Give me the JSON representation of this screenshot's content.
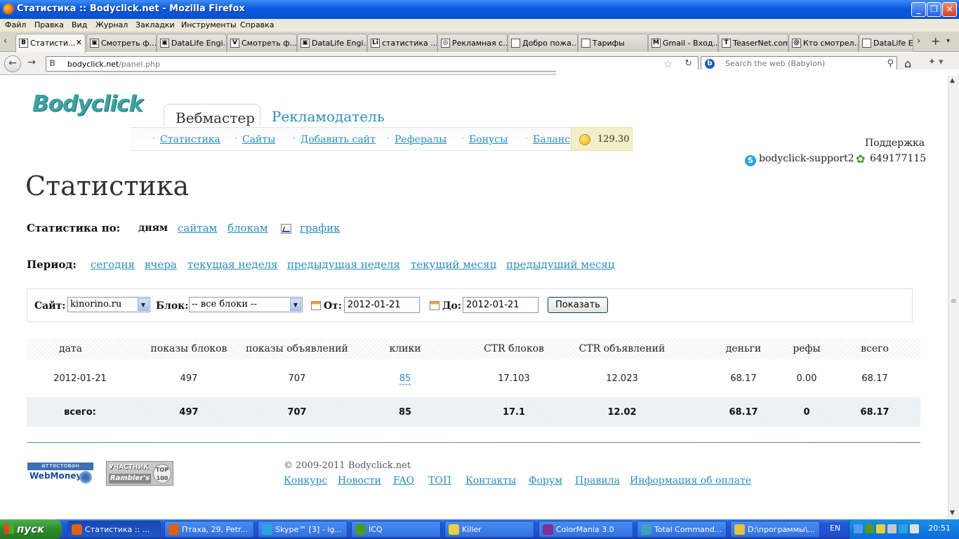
{
  "window": {
    "title": "Статистика :: Bodyclick.net - Mozilla Firefox"
  },
  "menu": [
    "Файл",
    "Правка",
    "Вид",
    "Журнал",
    "Закладки",
    "Инструменты",
    "Справка"
  ],
  "tabs": [
    {
      "label": "Статисти...",
      "icon": "B",
      "active": true
    },
    {
      "label": "Смотреть ф...",
      "icon": "▣"
    },
    {
      "label": "DataLife Engi...",
      "icon": "▣"
    },
    {
      "label": "Смотреть ф...",
      "icon": "V"
    },
    {
      "label": "DataLife Engi...",
      "icon": "▣"
    },
    {
      "label": "статистика ...",
      "icon": "Li"
    },
    {
      "label": "Рекламная с...",
      "icon": "◎"
    },
    {
      "label": "Добро пожа...",
      "icon": ""
    },
    {
      "label": "Тарифы",
      "icon": ""
    },
    {
      "label": "Gmail - Вход...",
      "icon": "M"
    },
    {
      "label": "TeaserNet.com",
      "icon": "T"
    },
    {
      "label": "Кто смотрел...",
      "icon": "@"
    },
    {
      "label": "DataLife En",
      "icon": ""
    }
  ],
  "nav": {
    "url_host": "bodyclick.net",
    "url_path": "/panel.php",
    "search_placeholder": "Search the web (Babylon)"
  },
  "site": {
    "logo": "Bodyclick",
    "main_tabs": {
      "webmaster": "Вебмастер",
      "advertiser": "Рекламодатель"
    },
    "subnav": [
      "Статистика",
      "Сайты",
      "Добавить сайт",
      "Рефералы",
      "Бонусы",
      "Баланс"
    ],
    "balance": "129.30",
    "support": {
      "label": "Поддержка",
      "skype": "bodyclick-support2",
      "icq": "649177115"
    }
  },
  "page": {
    "title": "Статистика",
    "stat_by": {
      "label": "Статистика по:",
      "current": "дням",
      "links": [
        "сайтам",
        "блокам",
        "график"
      ]
    },
    "period": {
      "label": "Период:",
      "links": [
        "сегодня",
        "вчера",
        "текущая неделя",
        "предыдущая неделя",
        "текущий месяц",
        "предыдущий месяц"
      ]
    },
    "filter": {
      "site_label": "Сайт:",
      "site_value": "kinorino.ru",
      "block_label": "Блок:",
      "block_value": "-- все блоки --",
      "from_label": "От:",
      "from_value": "2012-01-21",
      "to_label": "До:",
      "to_value": "2012-01-21",
      "show_button": "Показать"
    },
    "table": {
      "headers": [
        "дата",
        "показы блоков",
        "показы объявлений",
        "клики",
        "CTR блоков",
        "CTR объявлений",
        "деньги",
        "рефы",
        "всего"
      ],
      "rows": [
        [
          "2012-01-21",
          "497",
          "707",
          "85",
          "17.103",
          "12.023",
          "68.17",
          "0.00",
          "68.17"
        ]
      ],
      "total": [
        "всего:",
        "497",
        "707",
        "85",
        "17.1",
        "12.02",
        "68.17",
        "0",
        "68.17"
      ]
    }
  },
  "footer": {
    "webmoney_top": "аттестован",
    "webmoney_bottom": "WebMoney",
    "rambler_top": "УЧАСТНИК",
    "rambler_bottom": "Rambler's",
    "rambler_badge": "TOP 100",
    "copyright": "© 2009-2011 Bodyclick.net",
    "links": [
      "Конкурс",
      "Новости",
      "FAQ",
      "ТОП",
      "Контакты",
      "Форум",
      "Правила",
      "Информация об оплате"
    ]
  },
  "taskbar": {
    "start": "пуск",
    "items": [
      {
        "label": "Статистика :: ...",
        "color": "#e06010"
      },
      {
        "label": "Птаха, 29, Petr...",
        "color": "#e06010"
      },
      {
        "label": "Skype™ [3] - ig...",
        "color": "#2aa3e0"
      },
      {
        "label": "ICQ",
        "color": "#4c9a20"
      },
      {
        "label": "Killer",
        "color": "#e8d040"
      },
      {
        "label": "ColorMania 3.0",
        "color": "#803090"
      },
      {
        "label": "Total Command...",
        "color": "#40a0c0"
      },
      {
        "label": "D:\\программы\\...",
        "color": "#e8c040"
      }
    ],
    "lang": "EN",
    "time": "20:51"
  }
}
